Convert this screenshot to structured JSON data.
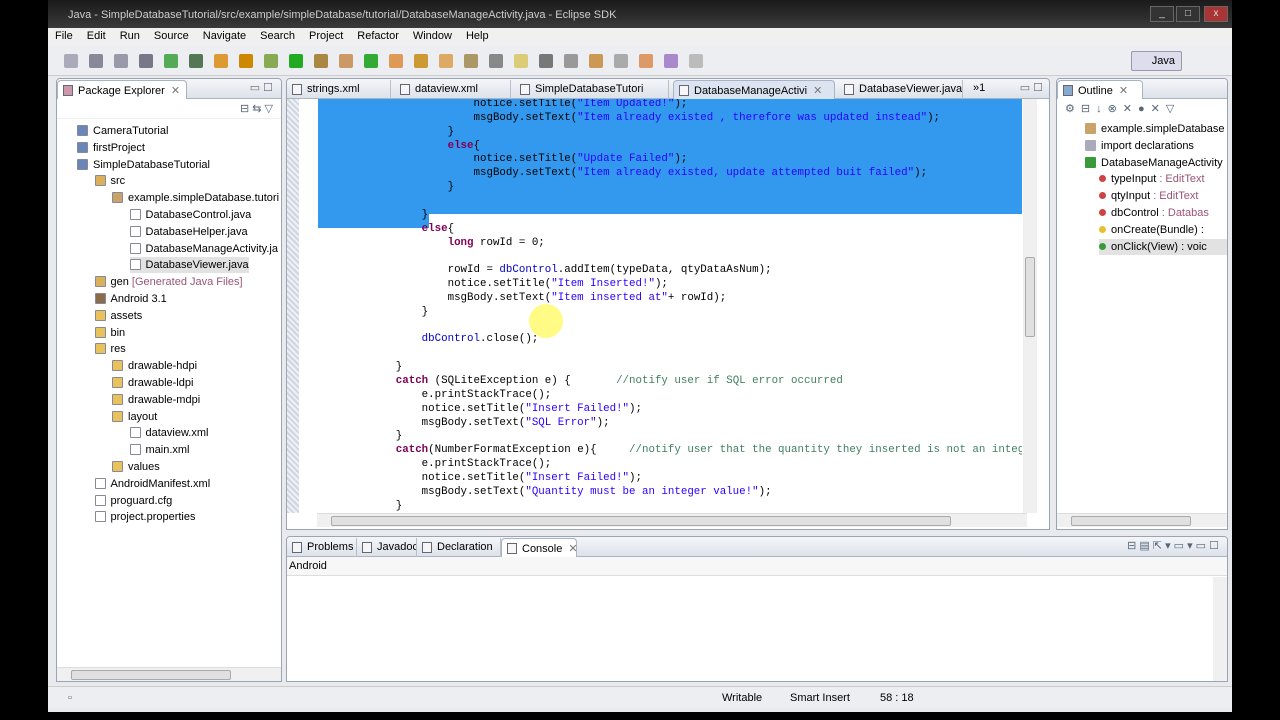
{
  "window": {
    "title": "Java - SimpleDatabaseTutorial/src/example/simpleDatabase/tutorial/DatabaseManageActivity.java - Eclipse SDK"
  },
  "menu": [
    "File",
    "Edit",
    "Run",
    "Source",
    "Navigate",
    "Search",
    "Project",
    "Refactor",
    "Window",
    "Help"
  ],
  "perspective": {
    "label": "Java"
  },
  "package_explorer": {
    "title": "Package Explorer",
    "items": [
      {
        "label": "CameraTutorial",
        "depth": 0,
        "icon": "project-icon"
      },
      {
        "label": "firstProject",
        "depth": 0,
        "icon": "project-icon"
      },
      {
        "label": "SimpleDatabaseTutorial",
        "depth": 0,
        "icon": "project-icon"
      },
      {
        "label": "src",
        "depth": 1,
        "icon": "source-folder-icon"
      },
      {
        "label": "example.simpleDatabase.tutori",
        "depth": 2,
        "icon": "package-icon"
      },
      {
        "label": "DatabaseControl.java",
        "depth": 3,
        "icon": "java-file-icon"
      },
      {
        "label": "DatabaseHelper.java",
        "depth": 3,
        "icon": "java-file-icon"
      },
      {
        "label": "DatabaseManageActivity.ja",
        "depth": 3,
        "icon": "java-file-icon"
      },
      {
        "label": "DatabaseViewer.java",
        "depth": 3,
        "icon": "java-file-icon",
        "selected": true
      },
      {
        "label": "gen",
        "suffix": " [Generated Java Files]",
        "depth": 1,
        "icon": "source-folder-icon"
      },
      {
        "label": "Android 3.1",
        "depth": 1,
        "icon": "library-icon"
      },
      {
        "label": "assets",
        "depth": 1,
        "icon": "folder-icon"
      },
      {
        "label": "bin",
        "depth": 1,
        "icon": "folder-icon"
      },
      {
        "label": "res",
        "depth": 1,
        "icon": "folder-icon"
      },
      {
        "label": "drawable-hdpi",
        "depth": 2,
        "icon": "folder-icon"
      },
      {
        "label": "drawable-ldpi",
        "depth": 2,
        "icon": "folder-icon"
      },
      {
        "label": "drawable-mdpi",
        "depth": 2,
        "icon": "folder-icon"
      },
      {
        "label": "layout",
        "depth": 2,
        "icon": "folder-icon"
      },
      {
        "label": "dataview.xml",
        "depth": 3,
        "icon": "xml-file-icon"
      },
      {
        "label": "main.xml",
        "depth": 3,
        "icon": "xml-file-icon"
      },
      {
        "label": "values",
        "depth": 2,
        "icon": "folder-icon"
      },
      {
        "label": "AndroidManifest.xml",
        "depth": 1,
        "icon": "xml-file-icon"
      },
      {
        "label": "proguard.cfg",
        "depth": 1,
        "icon": "file-icon"
      },
      {
        "label": "project.properties",
        "depth": 1,
        "icon": "file-icon"
      }
    ]
  },
  "editor": {
    "tabs": [
      {
        "label": "strings.xml"
      },
      {
        "label": "dataview.xml"
      },
      {
        "label": "SimpleDatabaseTutori"
      },
      {
        "label": "DatabaseManageActivi",
        "active": true
      },
      {
        "label": "DatabaseViewer.java"
      }
    ],
    "overflow": "»1",
    "lines": [
      [
        [
          "",
          "                        notice.setTitle("
        ],
        [
          "str",
          "\"Item Updated!\""
        ],
        [
          "",
          ");"
        ]
      ],
      [
        [
          "",
          "                        msgBody.setText("
        ],
        [
          "str",
          "\"Item already existed , therefore was updated instead\""
        ],
        [
          "",
          ");"
        ]
      ],
      [
        [
          "",
          "                    }"
        ]
      ],
      [
        [
          "",
          "                    "
        ],
        [
          "kw",
          "else"
        ],
        [
          "",
          "{"
        ]
      ],
      [
        [
          "",
          "                        notice.setTitle("
        ],
        [
          "str",
          "\"Update Failed\""
        ],
        [
          "",
          ");"
        ]
      ],
      [
        [
          "",
          "                        msgBody.setText("
        ],
        [
          "str",
          "\"Item already existed, update attempted buit failed\""
        ],
        [
          "",
          ");"
        ]
      ],
      [
        [
          "",
          "                    }"
        ]
      ],
      [
        [
          "",
          ""
        ]
      ],
      [
        [
          "",
          "                }"
        ]
      ],
      [
        [
          "",
          "                "
        ],
        [
          "kw",
          "else"
        ],
        [
          "",
          "{"
        ]
      ],
      [
        [
          "",
          "                    "
        ],
        [
          "kw",
          "long"
        ],
        [
          "",
          " rowId = 0;"
        ]
      ],
      [
        [
          "",
          ""
        ]
      ],
      [
        [
          "",
          "                    rowId = "
        ],
        [
          "fld",
          "dbControl"
        ],
        [
          "",
          ".addItem(typeData, qtyDataAsNum);"
        ]
      ],
      [
        [
          "",
          "                    notice.setTitle("
        ],
        [
          "str",
          "\"Item Inserted!\""
        ],
        [
          "",
          ");"
        ]
      ],
      [
        [
          "",
          "                    msgBody.setText("
        ],
        [
          "str",
          "\"Item inserted at\""
        ],
        [
          "",
          "+ rowId);"
        ]
      ],
      [
        [
          "",
          "                }"
        ]
      ],
      [
        [
          "",
          ""
        ]
      ],
      [
        [
          "",
          "                "
        ],
        [
          "fld",
          "dbControl"
        ],
        [
          "",
          ".close();"
        ]
      ],
      [
        [
          "",
          ""
        ]
      ],
      [
        [
          "",
          "            }"
        ]
      ],
      [
        [
          "",
          "            "
        ],
        [
          "kw",
          "catch"
        ],
        [
          "",
          " (SQLiteException e) {       "
        ],
        [
          "cm",
          "//notify user if SQL error occurred"
        ]
      ],
      [
        [
          "",
          "                e.printStackTrace();"
        ]
      ],
      [
        [
          "",
          "                notice.setTitle("
        ],
        [
          "str",
          "\"Insert Failed!\""
        ],
        [
          "",
          ");"
        ]
      ],
      [
        [
          "",
          "                msgBody.setText("
        ],
        [
          "str",
          "\"SQL Error\""
        ],
        [
          "",
          ");"
        ]
      ],
      [
        [
          "",
          "            }"
        ]
      ],
      [
        [
          "",
          "            "
        ],
        [
          "kw",
          "catch"
        ],
        [
          "",
          "(NumberFormatException e){     "
        ],
        [
          "cm",
          "//notify user that the quantity they inserted is not an integ"
        ]
      ],
      [
        [
          "",
          "                e.printStackTrace();"
        ]
      ],
      [
        [
          "",
          "                notice.setTitle("
        ],
        [
          "str",
          "\"Insert Failed!\""
        ],
        [
          "",
          ");"
        ]
      ],
      [
        [
          "",
          "                msgBody.setText("
        ],
        [
          "str",
          "\"Quantity must be an integer value!\""
        ],
        [
          "",
          ");"
        ]
      ],
      [
        [
          "",
          "            }"
        ]
      ]
    ]
  },
  "outline": {
    "title": "Outline",
    "items": [
      {
        "label": "example.simpleDatabase",
        "type": "",
        "depth": 0,
        "icon": "package-icon"
      },
      {
        "label": "import declarations",
        "type": "",
        "depth": 0,
        "icon": "imports-icon"
      },
      {
        "label": "DatabaseManageActivity",
        "type": "",
        "depth": 0,
        "icon": "class-icon"
      },
      {
        "label": "typeInput",
        "type": " : EditText",
        "depth": 1,
        "icon": "private-field-icon"
      },
      {
        "label": "qtyInput",
        "type": " : EditText",
        "depth": 1,
        "icon": "private-field-icon"
      },
      {
        "label": "dbControl",
        "type": " : Databas",
        "depth": 1,
        "icon": "private-field-icon"
      },
      {
        "label": "onCreate(Bundle) :",
        "type": "",
        "depth": 1,
        "icon": "protected-method-icon"
      },
      {
        "label": "onClick(View) : voic",
        "type": "",
        "depth": 1,
        "icon": "public-method-icon",
        "selected": true
      }
    ]
  },
  "bottom": {
    "tabs": [
      {
        "label": "Problems"
      },
      {
        "label": "Javadoc"
      },
      {
        "label": "Declaration"
      },
      {
        "label": "Console",
        "active": true
      }
    ],
    "console_label": "Android"
  },
  "status": {
    "writable": "Writable",
    "insert_mode": "Smart Insert",
    "position": "58 : 18"
  }
}
